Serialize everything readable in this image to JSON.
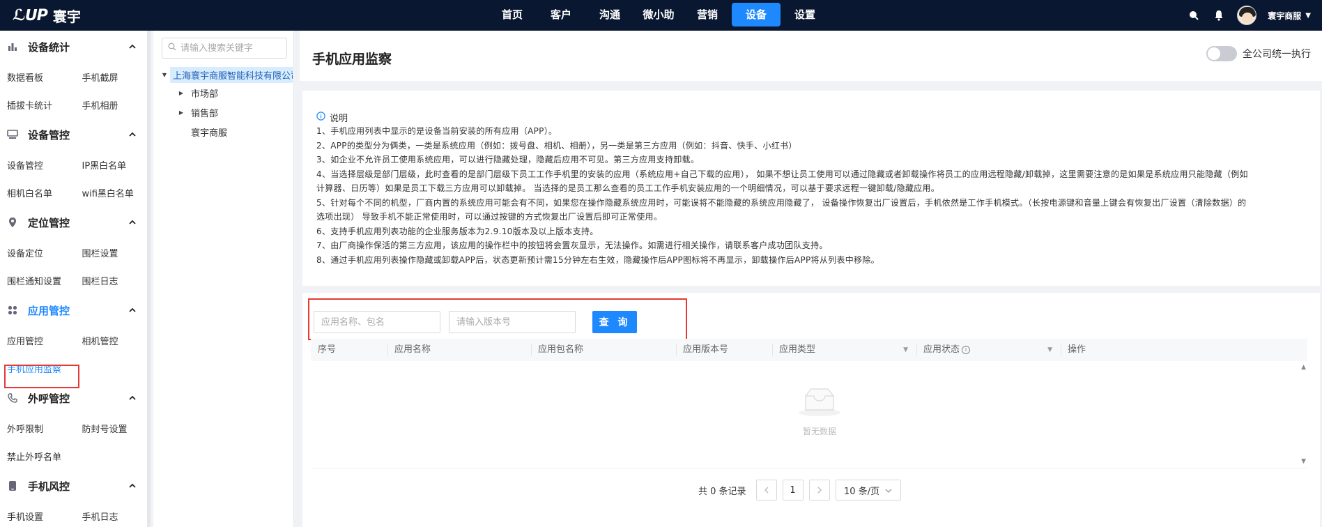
{
  "brand": {
    "mark": "ℒᑌP",
    "name": "寰宇"
  },
  "nav": [
    {
      "label": "首页"
    },
    {
      "label": "客户"
    },
    {
      "label": "沟通"
    },
    {
      "label": "微小助"
    },
    {
      "label": "营销"
    },
    {
      "label": "设备",
      "active": true
    },
    {
      "label": "设置"
    }
  ],
  "user": {
    "name": "寰宇商服"
  },
  "sidebar": {
    "groups": [
      {
        "icon": "bar-chart-icon",
        "title": "设备统计",
        "items": [
          "数据看板",
          "手机截屏",
          "插拔卡统计",
          "手机相册"
        ]
      },
      {
        "icon": "device-icon",
        "title": "设备管控",
        "items": [
          "设备管控",
          "IP黑白名单",
          "相机白名单",
          "wifi黑白名单"
        ]
      },
      {
        "icon": "location-icon",
        "title": "定位管控",
        "items": [
          "设备定位",
          "围栏设置",
          "围栏通知设置",
          "围栏日志"
        ]
      },
      {
        "icon": "apps-icon",
        "title": "应用管控",
        "active": true,
        "items": [
          "应用管控",
          "相机管控",
          "手机应用监察"
        ]
      },
      {
        "icon": "phone-icon",
        "title": "外呼管控",
        "items": [
          "外呼限制",
          "防封号设置",
          "禁止外呼名单"
        ]
      },
      {
        "icon": "phone-risk-icon",
        "title": "手机风控",
        "items": [
          "手机设置",
          "手机日志"
        ]
      }
    ]
  },
  "tree": {
    "search_placeholder": "请输入搜索关键字",
    "root": "上海寰宇商服智能科技有限公司",
    "children": [
      "市场部",
      "销售部",
      "寰宇商服"
    ]
  },
  "page": {
    "title": "手机应用监察",
    "toggle_label": "全公司统一执行",
    "toggle_on": false
  },
  "description": {
    "heading": "说明",
    "lines": [
      "1、手机应用列表中显示的是设备当前安装的所有应用（APP）。",
      "2、APP的类型分为俩类，一类是系统应用（例如：拨号盘、相机、相册），另一类是第三方应用（例如：抖音、快手、小红书）",
      "3、如企业不允许员工使用系统应用，可以进行隐藏处理，隐藏后应用不可见。第三方应用支持卸载。",
      "4、当选择层级是部门层级，此时查看的是部门层级下员工工作手机里的安装的应用（系统应用+自己下载的应用）， 如果不想让员工使用可以通过隐藏或者卸载操作将员工的应用远程隐藏/卸载掉，这里需要注意的是如果是系统应用只能隐藏（例如",
      "计算器、日历等）如果是员工下载三方应用可以卸载掉。 当选择的是员工那么查看的员工工作手机安装应用的一个明细情况，可以基于要求远程一键卸载/隐藏应用。",
      "5、针对每个不同的机型，厂商内置的系统应用可能会有不同，如果您在操作隐藏系统应用时，可能误将不能隐藏的系统应用隐藏了， 设备操作恢复出厂设置后，手机依然是工作手机模式。（长按电源键和音量上键会有恢复出厂设置（清除数据）的",
      "选项出现） 导致手机不能正常使用时，可以通过按键的方式恢复出厂设置后即可正常使用。",
      "6、支持手机应用列表功能的企业服务版本为2.9.10版本及以上版本支持。",
      "7、由厂商操作保活的第三方应用，该应用的操作栏中的按钮将会置灰显示，无法操作。如需进行相关操作，请联系客户成功团队支持。",
      "8、通过手机应用列表操作隐藏或卸载APP后，状态更新预计需15分钟左右生效，隐藏操作后APP图标将不再显示，卸载操作后APP将从列表中移除。"
    ]
  },
  "filters": {
    "name_placeholder": "应用名称、包名",
    "version_placeholder": "请输入版本号",
    "query_label": "查 询"
  },
  "table": {
    "columns": [
      "序号",
      "应用名称",
      "应用包名称",
      "应用版本号",
      "应用类型",
      "应用状态",
      "操作"
    ],
    "empty_text": "暂无数据"
  },
  "pagination": {
    "total_text": "共 0 条记录",
    "current_page": "1",
    "page_size": "10 条/页"
  },
  "colors": {
    "accent": "#1e88ff",
    "topbar": "#0a1730",
    "highlight": "#e53935"
  }
}
